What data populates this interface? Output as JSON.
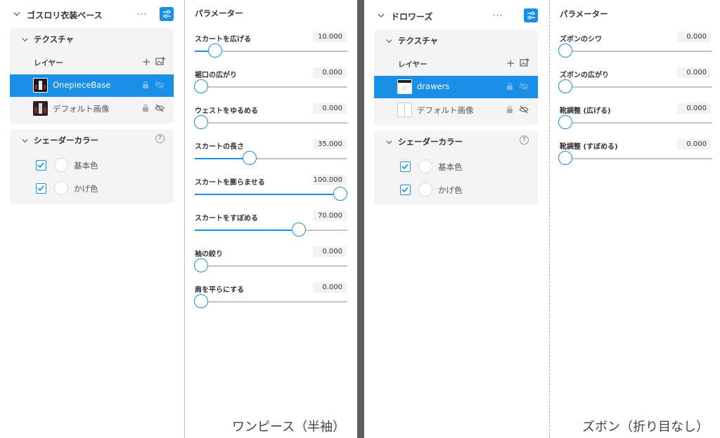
{
  "colors": {
    "accent": "#1a8fe8",
    "card_bg": "#f4f4f4",
    "track": "#c4c4c4"
  },
  "left_group": {
    "header": {
      "title": "ゴスロリ衣装ベース",
      "more": "···",
      "settings_icon": "sliders-icon"
    },
    "texture": {
      "title": "テクスチャ",
      "layer_label": "レイヤー",
      "add": "+",
      "layers": [
        {
          "name": "OnepieceBase",
          "selected": true
        },
        {
          "name": "デフォルト画像",
          "selected": false
        }
      ]
    },
    "shader": {
      "title": "シェーダーカラー",
      "help": "?",
      "items": [
        {
          "name": "基本色",
          "checked": true
        },
        {
          "name": "かげ色",
          "checked": true
        }
      ]
    },
    "params": {
      "title": "パラメーター",
      "items": [
        {
          "name": "スカートを広げる",
          "value": "10.000",
          "level": 0.1
        },
        {
          "name": "裾口の広がり",
          "value": "0.000",
          "level": 0.0
        },
        {
          "name": "ウェストをゆるめる",
          "value": "0.000",
          "level": 0.0
        },
        {
          "name": "スカートの長さ",
          "value": "35.000",
          "level": 0.35
        },
        {
          "name": "スカートを膨らませる",
          "value": "100.000",
          "level": 1.0
        },
        {
          "name": "スカートをすぼめる",
          "value": "70.000",
          "level": 0.7
        },
        {
          "name": "袖の絞り",
          "value": "0.000",
          "level": 0.0
        },
        {
          "name": "肩を平らにする",
          "value": "0.000",
          "level": 0.0
        }
      ]
    },
    "caption": "ワンピース（半袖）"
  },
  "right_group": {
    "header": {
      "title": "ドロワーズ",
      "more": "···",
      "settings_icon": "sliders-icon"
    },
    "texture": {
      "title": "テクスチャ",
      "layer_label": "レイヤー",
      "add": "+",
      "layers": [
        {
          "name": "drawers",
          "selected": true
        },
        {
          "name": "デフォルト画像",
          "selected": false
        }
      ]
    },
    "shader": {
      "title": "シェーダーカラー",
      "help": "?",
      "items": [
        {
          "name": "基本色",
          "checked": true
        },
        {
          "name": "かげ色",
          "checked": true
        }
      ]
    },
    "params": {
      "title": "パラメーター",
      "items": [
        {
          "name": "ズボンのシワ",
          "value": "0.000",
          "level": 0.0
        },
        {
          "name": "ズボンの広がり",
          "value": "0.000",
          "level": 0.0
        },
        {
          "name": "靴調整 (広げる)",
          "value": "0.000",
          "level": 0.0
        },
        {
          "name": "靴調整 (すぼめる)",
          "value": "0.000",
          "level": 0.0
        }
      ]
    },
    "caption": "ズボン（折り目なし）"
  }
}
